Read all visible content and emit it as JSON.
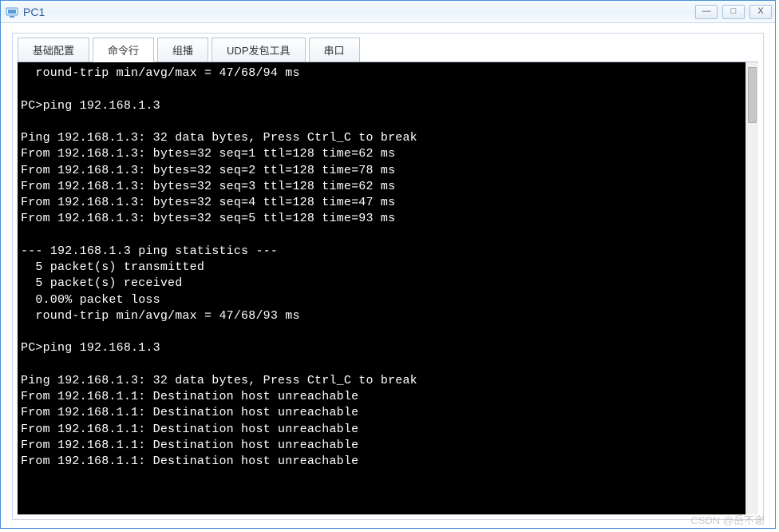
{
  "window": {
    "title": "PC1",
    "controls": {
      "minimize_glyph": "—",
      "maximize_glyph": "□",
      "close_glyph": "X"
    }
  },
  "tabs": [
    {
      "label": "基础配置",
      "active": false
    },
    {
      "label": "命令行",
      "active": true
    },
    {
      "label": "组播",
      "active": false
    },
    {
      "label": "UDP发包工具",
      "active": false
    },
    {
      "label": "串口",
      "active": false
    }
  ],
  "terminal": {
    "lines": [
      "  round-trip min/avg/max = 47/68/94 ms",
      "",
      "PC>ping 192.168.1.3",
      "",
      "Ping 192.168.1.3: 32 data bytes, Press Ctrl_C to break",
      "From 192.168.1.3: bytes=32 seq=1 ttl=128 time=62 ms",
      "From 192.168.1.3: bytes=32 seq=2 ttl=128 time=78 ms",
      "From 192.168.1.3: bytes=32 seq=3 ttl=128 time=62 ms",
      "From 192.168.1.3: bytes=32 seq=4 ttl=128 time=47 ms",
      "From 192.168.1.3: bytes=32 seq=5 ttl=128 time=93 ms",
      "",
      "--- 192.168.1.3 ping statistics ---",
      "  5 packet(s) transmitted",
      "  5 packet(s) received",
      "  0.00% packet loss",
      "  round-trip min/avg/max = 47/68/93 ms",
      "",
      "PC>ping 192.168.1.3",
      "",
      "Ping 192.168.1.3: 32 data bytes, Press Ctrl_C to break",
      "From 192.168.1.1: Destination host unreachable",
      "From 192.168.1.1: Destination host unreachable",
      "From 192.168.1.1: Destination host unreachable",
      "From 192.168.1.1: Destination host unreachable",
      "From 192.168.1.1: Destination host unreachable",
      ""
    ]
  },
  "watermark": "CSDN @岳不谢"
}
